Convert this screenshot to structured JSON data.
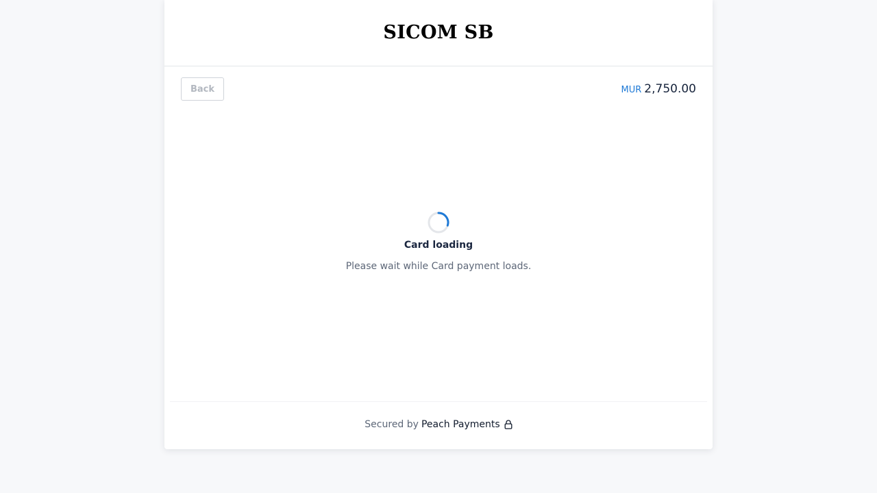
{
  "merchant": {
    "name": "SICOM SB"
  },
  "topbar": {
    "back_label": "Back"
  },
  "amount": {
    "currency": "MUR",
    "value": "2,750.00"
  },
  "loading": {
    "title": "Card loading",
    "message": "Please wait while Card payment loads."
  },
  "footer": {
    "secured_text": "Secured by",
    "provider_name": "Peach Payments"
  },
  "icons": {
    "spinner": "loading-spinner-icon",
    "lock": "lock-icon"
  },
  "colors": {
    "accent": "#1f7ad6",
    "page_background": "#f7f8fa",
    "text_dark": "#16233b",
    "text_muted": "#5d6778"
  }
}
